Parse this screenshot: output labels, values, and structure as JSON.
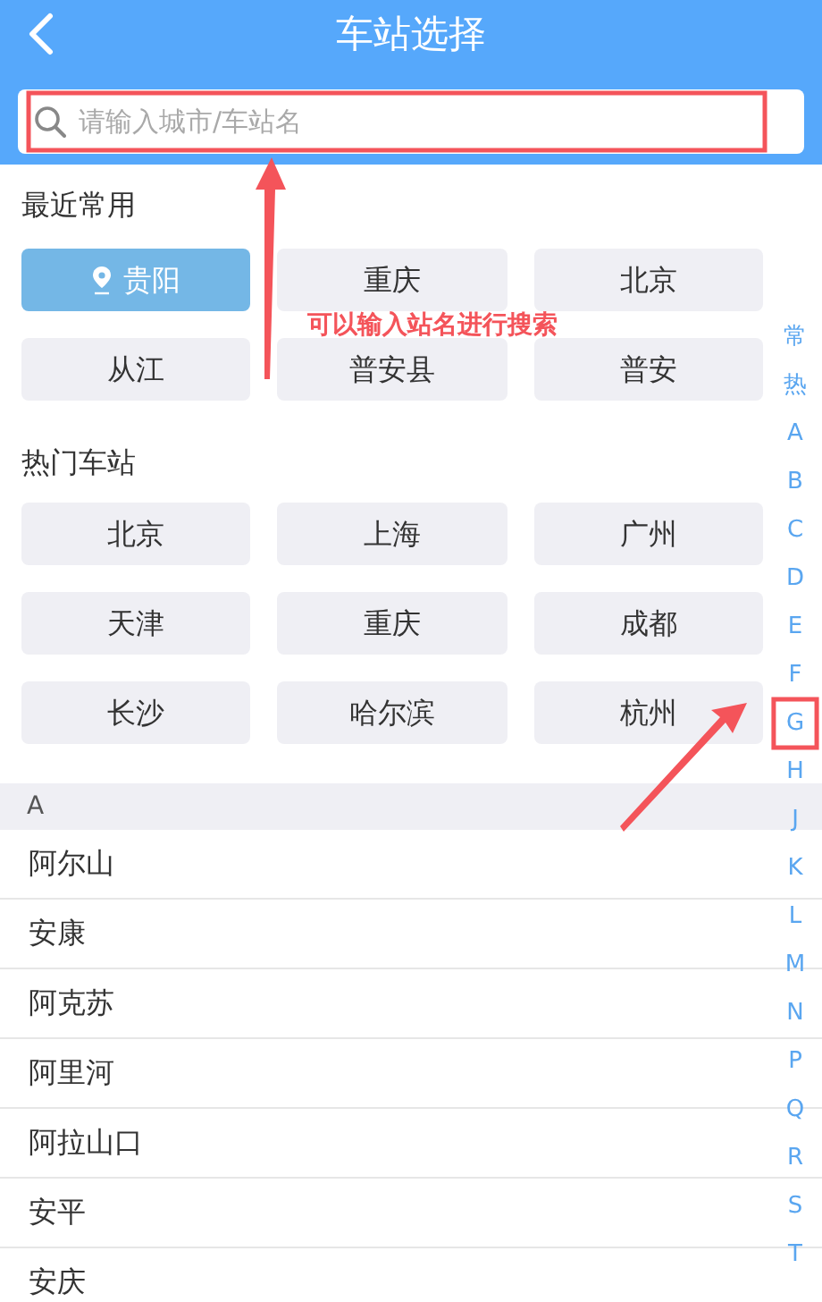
{
  "header": {
    "title": "车站选择"
  },
  "search": {
    "placeholder": "请输入城市/车站名"
  },
  "recent": {
    "title": "最近常用",
    "items": [
      {
        "name": "贵阳",
        "current": true
      },
      {
        "name": "重庆",
        "current": false
      },
      {
        "name": "北京",
        "current": false
      },
      {
        "name": "从江",
        "current": false
      },
      {
        "name": "普安县",
        "current": false
      },
      {
        "name": "普安",
        "current": false
      }
    ]
  },
  "hot": {
    "title": "热门车站",
    "items": [
      "北京",
      "上海",
      "广州",
      "天津",
      "重庆",
      "成都",
      "长沙",
      "哈尔滨",
      "杭州"
    ]
  },
  "section": {
    "letter": "A",
    "stations": [
      "阿尔山",
      "安康",
      "阿克苏",
      "阿里河",
      "阿拉山口",
      "安平",
      "安庆"
    ]
  },
  "index": [
    {
      "letter": "常",
      "highlighted": false
    },
    {
      "letter": "热",
      "highlighted": false
    },
    {
      "letter": "A",
      "highlighted": false
    },
    {
      "letter": "B",
      "highlighted": false
    },
    {
      "letter": "C",
      "highlighted": false
    },
    {
      "letter": "D",
      "highlighted": false
    },
    {
      "letter": "E",
      "highlighted": false
    },
    {
      "letter": "F",
      "highlighted": false
    },
    {
      "letter": "G",
      "highlighted": true
    },
    {
      "letter": "H",
      "highlighted": false
    },
    {
      "letter": "J",
      "highlighted": false
    },
    {
      "letter": "K",
      "highlighted": false
    },
    {
      "letter": "L",
      "highlighted": false
    },
    {
      "letter": "M",
      "highlighted": false
    },
    {
      "letter": "N",
      "highlighted": false
    },
    {
      "letter": "P",
      "highlighted": false
    },
    {
      "letter": "Q",
      "highlighted": false
    },
    {
      "letter": "R",
      "highlighted": false
    },
    {
      "letter": "S",
      "highlighted": false
    },
    {
      "letter": "T",
      "highlighted": false
    }
  ],
  "annotation": {
    "text": "可以输入站名进行搜索"
  }
}
